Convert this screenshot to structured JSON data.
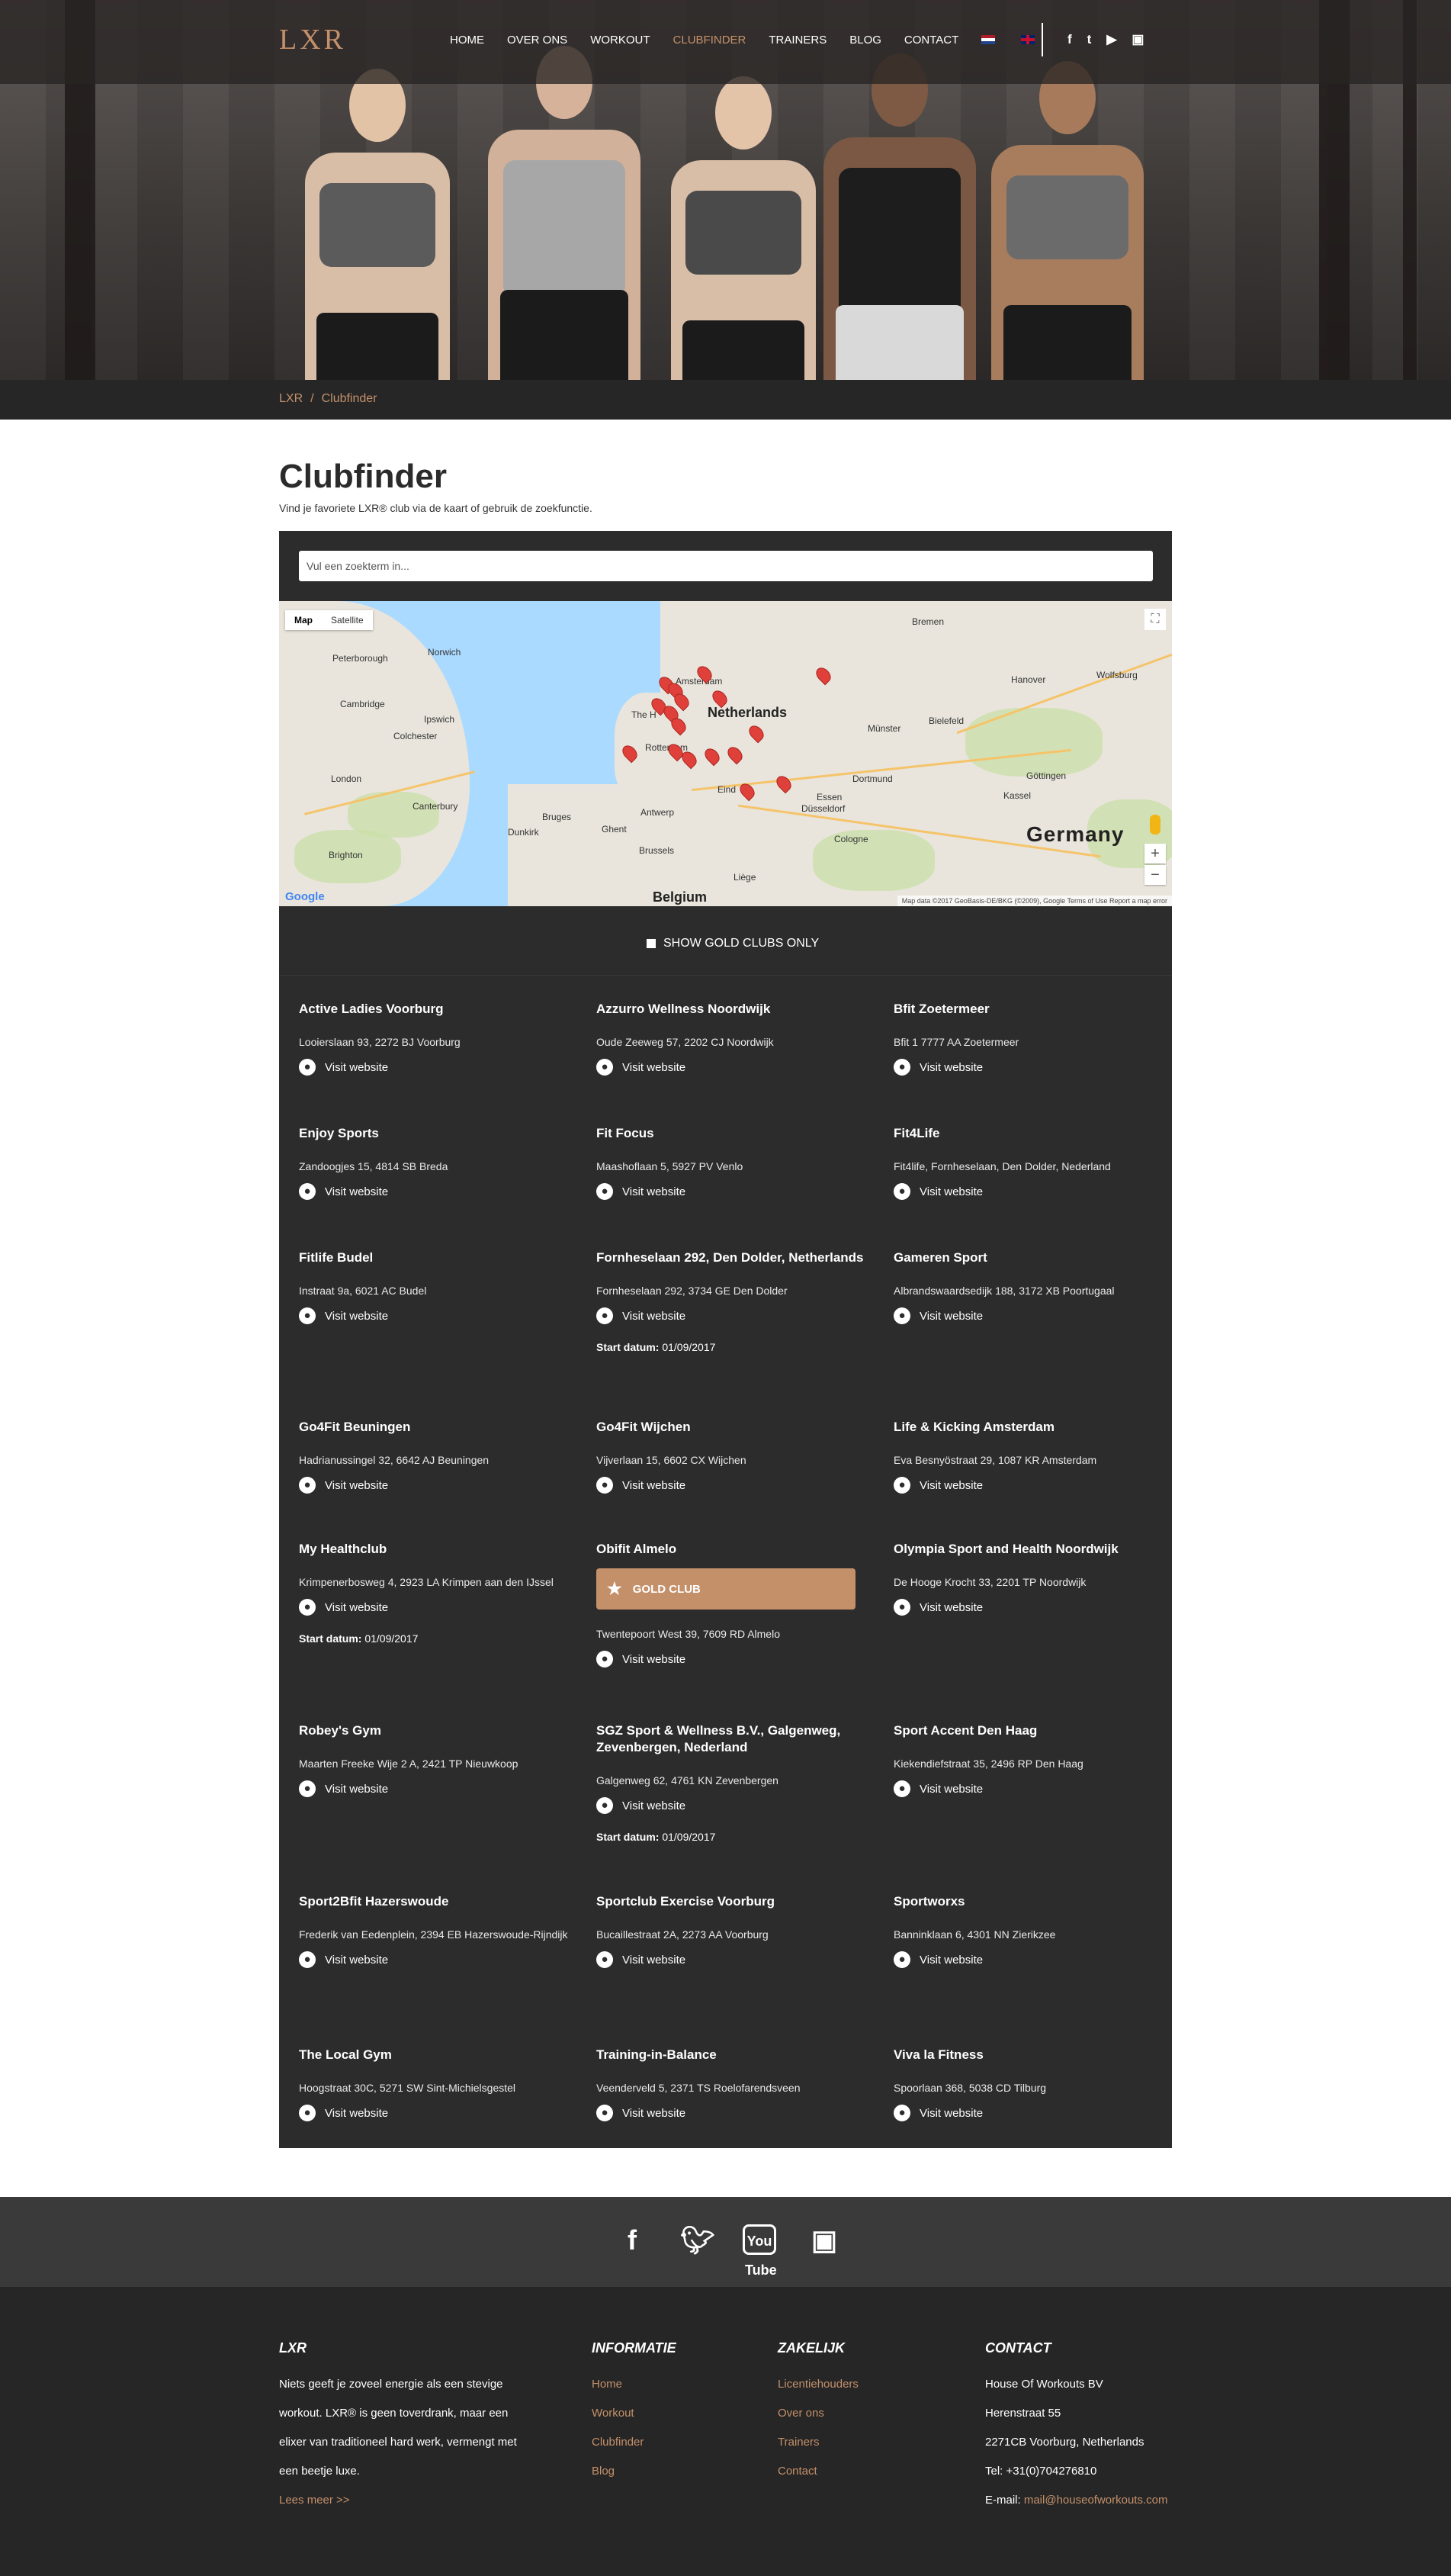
{
  "header": {
    "logo": "LXR",
    "nav": [
      "HOME",
      "OVER ONS",
      "WORKOUT",
      "CLUBFINDER",
      "TRAINERS",
      "BLOG",
      "CONTACT"
    ],
    "active_nav": "CLUBFINDER",
    "social": [
      "f",
      "t",
      "yt",
      "ig"
    ]
  },
  "breadcrumb": {
    "home": "LXR",
    "separator": "/",
    "current": "Clubfinder"
  },
  "page": {
    "title": "Clubfinder",
    "subtitle": "Vind je favoriete LXR® club via de kaart of gebruik de zoekfunctie."
  },
  "search": {
    "placeholder": "Vul een zoekterm in...",
    "value": ""
  },
  "map": {
    "tabs": [
      "Map",
      "Satellite"
    ],
    "active_tab": "Map",
    "labels": {
      "country_de": "Germany",
      "country_nl": "Netherlands",
      "country_be": "Belgium",
      "peterborough": "Peterborough",
      "norwich": "Norwich",
      "cambridge": "Cambridge",
      "ipswich": "Ipswich",
      "colchester": "Colchester",
      "london": "London",
      "canterbury": "Canterbury",
      "brighton": "Brighton",
      "dunkirk": "Dunkirk",
      "ghent": "Ghent",
      "brussels": "Brussels",
      "antwerp": "Antwerp",
      "liege": "Liège",
      "essen": "Essen",
      "dusseldorf": "Düsseldorf",
      "cologne": "Cologne",
      "dortmund": "Dortmund",
      "munster": "Münster",
      "bielefeld": "Bielefeld",
      "hanover": "Hanover",
      "wolfsburg": "Wolfsburg",
      "gottingen": "Göttingen",
      "kassel": "Kassel",
      "bremen": "Bremen",
      "amsterdam": "Amsterdam",
      "rotterdam": "Rotterdam",
      "the_hague": "The H",
      "bruges": "Bruges",
      "eindhoven": "Eind"
    },
    "google": "Google",
    "footer": "Map data ©2017 GeoBasis-DE/BKG (©2009), Google   Terms of Use   Report a map error"
  },
  "gold_filter": {
    "label": "SHOW GOLD CLUBS ONLY",
    "checked": false
  },
  "visit_label": "Visit website",
  "start_label": "Start datum:",
  "gold_label": "GOLD CLUB",
  "clubs": [
    {
      "name": "Active Ladies Voorburg",
      "address": "Looierslaan 93, 2272 BJ Voorburg"
    },
    {
      "name": "Azzurro Wellness Noordwijk",
      "address": "Oude Zeeweg 57, 2202 CJ Noordwijk"
    },
    {
      "name": "Bfit Zoetermeer",
      "address": "Bfit 1 7777 AA Zoetermeer"
    },
    {
      "name": "Enjoy Sports",
      "address": "Zandoogjes 15, 4814 SB Breda"
    },
    {
      "name": "Fit Focus",
      "address": "Maashoflaan 5, 5927 PV Venlo"
    },
    {
      "name": "Fit4Life",
      "address": "Fit4life, Fornheselaan, Den Dolder, Nederland"
    },
    {
      "name": "Fitlife Budel",
      "address": "Instraat 9a, 6021 AC Budel"
    },
    {
      "name": "Fornheselaan 292, Den Dolder, Netherlands",
      "address": "Fornheselaan 292, 3734 GE Den Dolder",
      "start": "01/09/2017"
    },
    {
      "name": "Gameren Sport",
      "address": "Albrandswaardsedijk 188, 3172 XB Poortugaal"
    },
    {
      "name": "Go4Fit Beuningen",
      "address": "Hadrianussingel 32, 6642 AJ Beuningen"
    },
    {
      "name": "Go4Fit Wijchen",
      "address": "Vijverlaan 15, 6602 CX Wijchen"
    },
    {
      "name": "Life & Kicking Amsterdam",
      "address": "Eva Besnyöstraat 29, 1087 KR Amsterdam"
    },
    {
      "name": "My Healthclub",
      "address": "Krimpenerbosweg 4, 2923 LA Krimpen aan den IJssel",
      "start": "01/09/2017"
    },
    {
      "name": "Obifit Almelo",
      "address": "Twentepoort West 39, 7609 RD Almelo",
      "gold": true
    },
    {
      "name": "Olympia Sport and Health Noordwijk",
      "address": "De Hooge Krocht 33, 2201 TP Noordwijk"
    },
    {
      "name": "Robey's Gym",
      "address": "Maarten Freeke Wije 2 A, 2421 TP Nieuwkoop"
    },
    {
      "name": "SGZ Sport & Wellness B.V., Galgenweg, Zevenbergen, Nederland",
      "address": "Galgenweg 62, 4761 KN Zevenbergen",
      "start": "01/09/2017"
    },
    {
      "name": "Sport Accent Den Haag",
      "address": "Kiekendiefstraat 35, 2496 RP Den Haag"
    },
    {
      "name": "Sport2Bfit Hazerswoude",
      "address": "Frederik van Eedenplein, 2394 EB Hazerswoude-Rijndijk"
    },
    {
      "name": "Sportclub Exercise Voorburg",
      "address": "Bucaillestraat 2A, 2273 AA Voorburg"
    },
    {
      "name": "Sportworxs",
      "address": "Banninklaan 6, 4301 NN Zierikzee"
    },
    {
      "name": "The Local Gym",
      "address": "Hoogstraat 30C, 5271 SW Sint-Michielsgestel"
    },
    {
      "name": "Training-in-Balance",
      "address": "Veenderveld 5, 2371 TS Roelofarendsveen"
    },
    {
      "name": "Viva la Fitness",
      "address": "Spoorlaan 368, 5038 CD Tilburg"
    }
  ],
  "footer": {
    "social": [
      "f",
      "t",
      "You Tube",
      "ig"
    ],
    "lxr": {
      "heading": "LXR",
      "lines": [
        "Niets geeft je zoveel energie als een stevige",
        "workout. LXR® is geen toverdrank, maar een",
        "elixer van traditioneel hard werk, vermengt met",
        "een beetje luxe."
      ],
      "more": "Lees meer >>"
    },
    "informatie": {
      "heading": "INFORMATIE",
      "links": [
        "Home",
        "Workout",
        "Clubfinder",
        "Blog"
      ]
    },
    "zakelijk": {
      "heading": "ZAKELIJK",
      "links": [
        "Licentiehouders",
        "Over ons",
        "Trainers",
        "Contact"
      ]
    },
    "contact": {
      "heading": "CONTACT",
      "lines": [
        "House Of Workouts BV",
        "Herenstraat 55",
        "2271CB Voorburg, Netherlands",
        "Tel: +31(0)704276810"
      ],
      "email_label": "E-mail:",
      "email": "mail@houseofworkouts.com"
    }
  },
  "colors": {
    "accent": "#c4906a",
    "panel": "#2c2c2c",
    "footer": "#262626"
  }
}
